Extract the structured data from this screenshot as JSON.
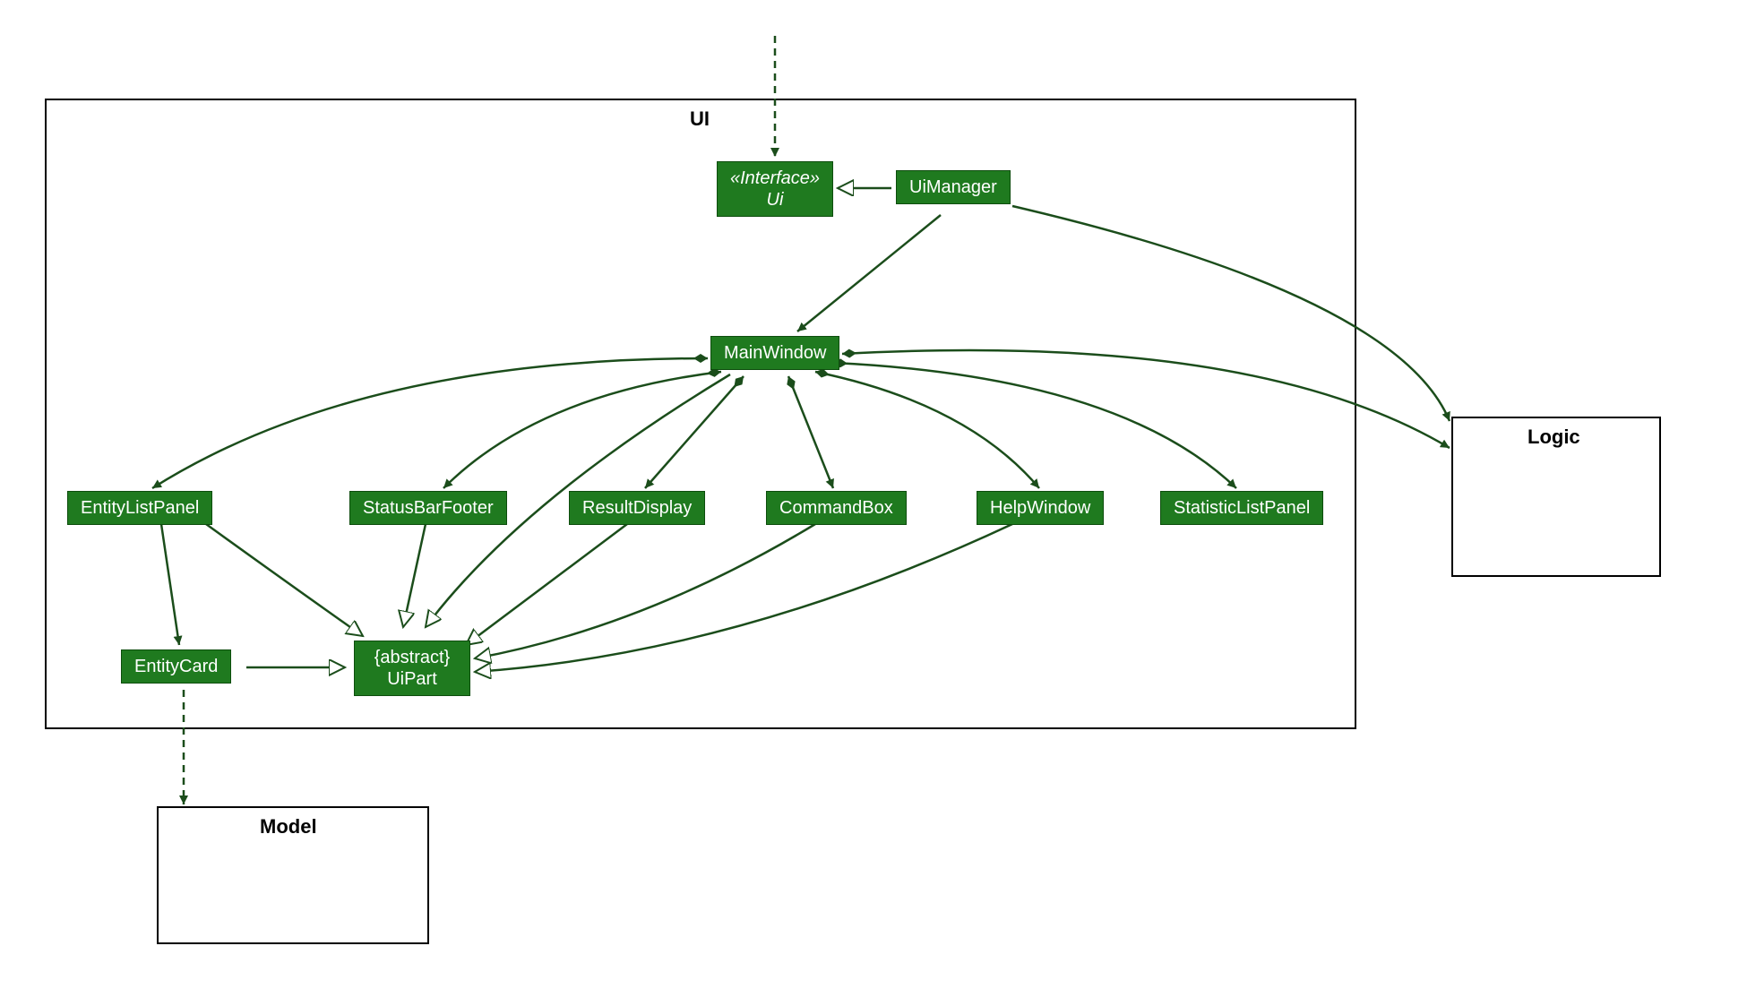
{
  "containers": {
    "ui": {
      "label": "UI"
    },
    "logic": {
      "label": "Logic"
    },
    "model": {
      "label": "Model"
    }
  },
  "nodes": {
    "interface_ui": {
      "line1": "«Interface»",
      "line2": "Ui"
    },
    "ui_manager": {
      "label": "UiManager"
    },
    "main_window": {
      "label": "MainWindow"
    },
    "entity_list_panel": {
      "label": "EntityListPanel"
    },
    "status_bar_footer": {
      "label": "StatusBarFooter"
    },
    "result_display": {
      "label": "ResultDisplay"
    },
    "command_box": {
      "label": "CommandBox"
    },
    "help_window": {
      "label": "HelpWindow"
    },
    "statistic_list_panel": {
      "label": "StatisticListPanel"
    },
    "entity_card": {
      "label": "EntityCard"
    },
    "ui_part": {
      "line1": "{abstract}",
      "line2": "UiPart"
    }
  },
  "colors": {
    "node_fill": "#1f7a1f",
    "edge": "#1b4d1b"
  }
}
